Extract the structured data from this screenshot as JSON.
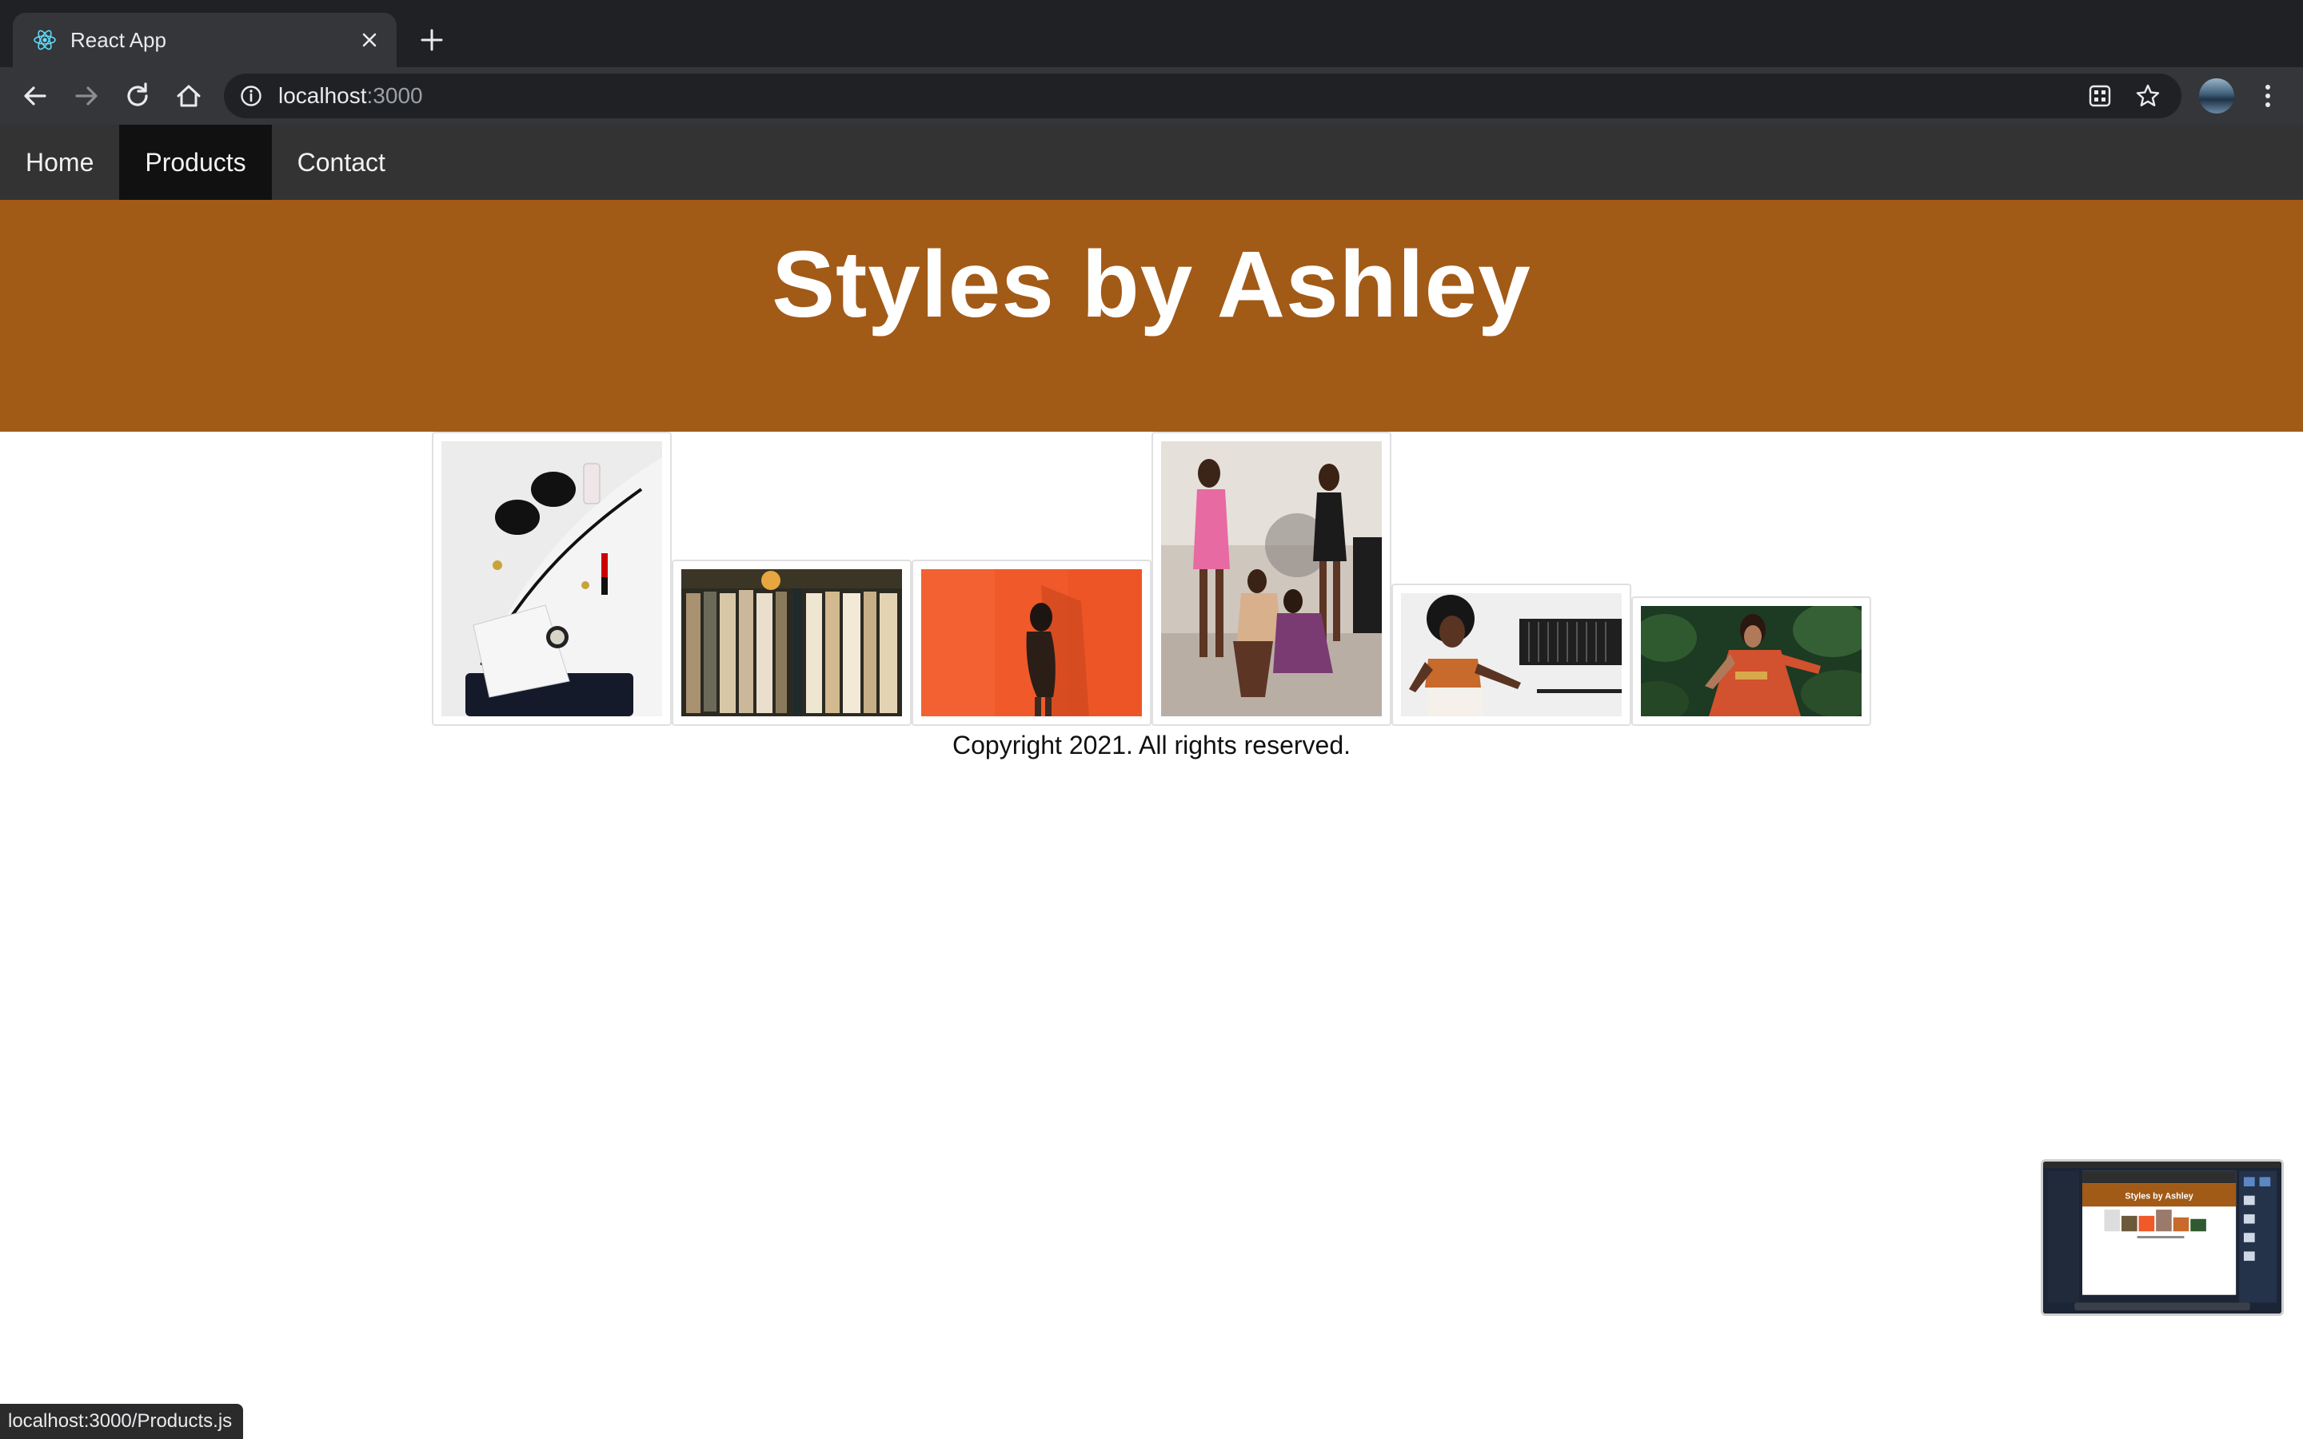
{
  "browser": {
    "tab_title": "React App",
    "url_host": "localhost",
    "url_port": ":3000",
    "status_url": "localhost:3000/Products.js",
    "icons": [
      "react-favicon",
      "close-icon",
      "plus-icon",
      "back-arrow-icon",
      "forward-arrow-icon",
      "reload-icon",
      "home-icon",
      "info-icon",
      "qr-code-icon",
      "star-icon",
      "avatar",
      "more-vert-icon"
    ]
  },
  "nav": {
    "items": [
      {
        "label": "Home",
        "active": false
      },
      {
        "label": "Products",
        "active": true
      },
      {
        "label": "Contact",
        "active": false
      }
    ]
  },
  "banner": {
    "title": "Styles by Ashley",
    "color": "#a25a17"
  },
  "gallery": {
    "images": [
      {
        "name": "accessories-flatlay"
      },
      {
        "name": "clothing-rack"
      },
      {
        "name": "model-orange-wall"
      },
      {
        "name": "group-of-models"
      },
      {
        "name": "model-orange-top"
      },
      {
        "name": "model-red-dress"
      }
    ]
  },
  "footer": {
    "text": "Copyright 2021. All rights reserved."
  },
  "thumbnail": {
    "title": "Styles by Ashley"
  }
}
